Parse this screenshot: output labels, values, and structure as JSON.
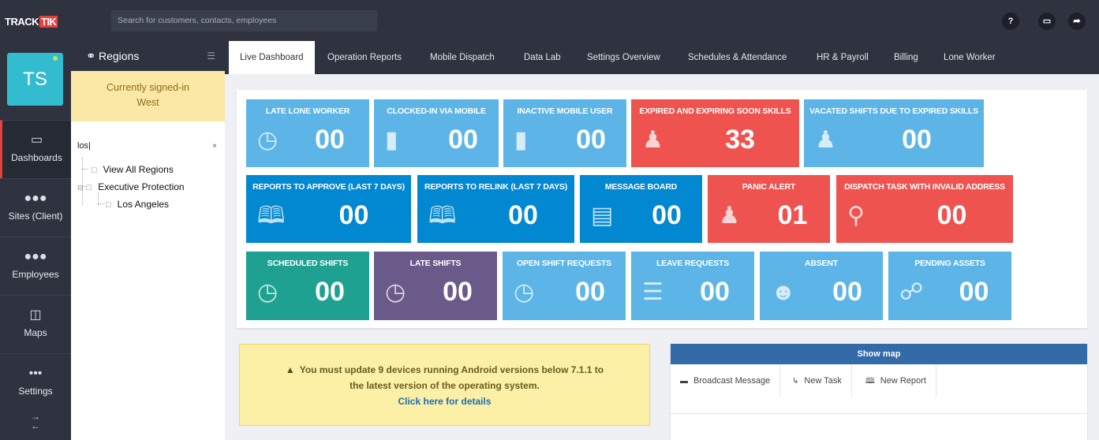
{
  "brand": {
    "logo_left": "TRACK",
    "logo_right": "TIK"
  },
  "search": {
    "placeholder": "Search for customers, contacts, employees"
  },
  "top_icons": [
    {
      "name": "help-icon",
      "glyph": "?"
    },
    {
      "name": "monitor-icon",
      "glyph": "▭"
    },
    {
      "name": "share-icon",
      "glyph": "➦"
    }
  ],
  "user": {
    "initials": "TS"
  },
  "nav": {
    "dashboards": "Dashboards",
    "sites": "Sites (Client)",
    "employees": "Employees",
    "maps": "Maps",
    "settings": "Settings"
  },
  "regions": {
    "title": "Regions",
    "signed_in_line1": "Currently signed-in",
    "signed_in_line2": "West",
    "search_value": "los",
    "clear": "×",
    "tree": [
      "View All Regions",
      "Executive Protection",
      "Los Angeles"
    ]
  },
  "tabs": [
    "Live Dashboard",
    "Operation Reports",
    "Mobile Dispatch",
    "Data Lab",
    "Settings Overview",
    "Schedules & Attendance",
    "HR & Payroll",
    "Billing",
    "Lone Worker"
  ],
  "tiles": [
    {
      "title": "LATE LONE WORKER",
      "value": "00",
      "icon": "clock-icon"
    },
    {
      "title": "CLOCKED-IN VIA MOBILE",
      "value": "00",
      "icon": "mobile-phone-icon"
    },
    {
      "title": "INACTIVE MOBILE USER",
      "value": "00",
      "icon": "mobile-phone-icon"
    },
    {
      "title": "EXPIRED AND EXPIRING SOON SKILLS",
      "value": "33",
      "icon": "user-badge-icon"
    },
    {
      "title": "VACATED SHIFTS DUE TO EXPIRED SKILLS",
      "value": "00",
      "icon": "user-badge-icon"
    },
    {
      "title": "REPORTS TO APPROVE (LAST 7 DAYS)",
      "value": "00",
      "icon": "book-icon"
    },
    {
      "title": "REPORTS TO RELINK (LAST 7 DAYS)",
      "value": "00",
      "icon": "book-icon"
    },
    {
      "title": "MESSAGE BOARD",
      "value": "00",
      "icon": "clipboard-icon"
    },
    {
      "title": "PANIC ALERT",
      "value": "01",
      "icon": "user-badge-icon"
    },
    {
      "title": "DISPATCH TASK WITH INVALID ADDRESS",
      "value": "00",
      "icon": "map-pin-icon"
    },
    {
      "title": "SCHEDULED SHIFTS",
      "value": "00",
      "icon": "clock-icon"
    },
    {
      "title": "LATE SHIFTS",
      "value": "00",
      "icon": "clock-icon"
    },
    {
      "title": "OPEN SHIFT REQUESTS",
      "value": "00",
      "icon": "clock-icon"
    },
    {
      "title": "LEAVE REQUESTS",
      "value": "00",
      "icon": "list-icon"
    },
    {
      "title": "ABSENT",
      "value": "00",
      "icon": "user-icon"
    },
    {
      "title": "PENDING ASSETS",
      "value": "00",
      "icon": "asset-tag-icon"
    }
  ],
  "alert": {
    "line1": "You must update 9 devices running Android versions below 7.1.1 to",
    "line2": "the latest version of the operating system.",
    "link": "Click here for details"
  },
  "map_widget": {
    "title": "Show map",
    "actions": [
      "Broadcast Message",
      "New Task",
      "New Report"
    ]
  },
  "colors": {
    "tile_light_blue": "#5cb5e6",
    "tile_dark_blue": "#0288d1",
    "tile_red": "#ef5350",
    "tile_teal": "#1fa191",
    "tile_purple": "#6a5a8a"
  }
}
